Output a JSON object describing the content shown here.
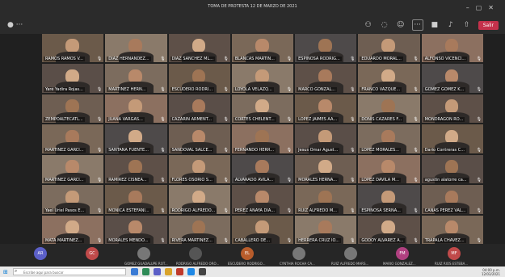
{
  "window": {
    "title": "TOMA DE PROTESTA 12 DE MARZO DE 2021"
  },
  "toolbar": {
    "leave_label": "Salir"
  },
  "tiles": [
    {
      "label": "RAMOS RAMOS V..."
    },
    {
      "label": "DIAZ HERNANDEZ..."
    },
    {
      "label": "DIAZ SANCHEZ ML..."
    },
    {
      "label": "BLANCAS MARTIN..."
    },
    {
      "label": "ESPINOSA RODRIG..."
    },
    {
      "label": "EDUARDO MORAL..."
    },
    {
      "label": "ALFONSO VICENCI..."
    },
    {
      "label": "Yaré Yadira Rojas..."
    },
    {
      "label": "MARTINEZ HERN..."
    },
    {
      "label": "ESCUDERO RODRI..."
    },
    {
      "label": "LOYOLA VELAZQ..."
    },
    {
      "label": "MARCO GONZAL..."
    },
    {
      "label": "FRANCO VAZQUE..."
    },
    {
      "label": "GOMEZ GOMEZ K..."
    },
    {
      "label": "ZEMPOALTECATL..."
    },
    {
      "label": "JUANA VARGAS..."
    },
    {
      "label": "CAZARIN ARMENT..."
    },
    {
      "label": "CORTES CHELENT..."
    },
    {
      "label": "LOPEZ JAIMES AA..."
    },
    {
      "label": "DONIS CAZARES F..."
    },
    {
      "label": "MONDRAGON RO..."
    },
    {
      "label": "MARTINEZ GARCI..."
    },
    {
      "label": "SANTANA FUENTE..."
    },
    {
      "label": "SANDOVAL SALCE..."
    },
    {
      "label": "FERNANDO HERR..."
    },
    {
      "label": "Jesus Omar Agust..."
    },
    {
      "label": "LOPEZ MORALES..."
    },
    {
      "label": "Dario Contreras C..."
    },
    {
      "label": "MARTINEZ GARCI..."
    },
    {
      "label": "RAMIREZ CISNEA..."
    },
    {
      "label": "FLORES OSORIO S..."
    },
    {
      "label": "ALVARADO AVILA..."
    },
    {
      "label": "MORALES HERNA..."
    },
    {
      "label": "LOPEZ DAVILA M..."
    },
    {
      "label": "agustin alatorre ca..."
    },
    {
      "label": "Yael Uriel Pasos E..."
    },
    {
      "label": "MONICA ESTEFANI..."
    },
    {
      "label": "RODRIGO ALFREDO..."
    },
    {
      "label": "PEREZ ANAYA DIA..."
    },
    {
      "label": "RUIZ ALFREDO M..."
    },
    {
      "label": "ESPINOSA SERNA..."
    },
    {
      "label": "CAÑAS PEREZ VAL..."
    },
    {
      "label": "MATA MARTINEZ..."
    },
    {
      "label": "MORALES MENDO..."
    },
    {
      "label": "RIVERA MARTINEZ..."
    },
    {
      "label": "CABALLERO DE..."
    },
    {
      "label": "HERRERA CRUZ IO..."
    },
    {
      "label": "GODOY ALVAREZ A..."
    },
    {
      "label": "TRAPALA CHAVEZ..."
    }
  ],
  "strip": [
    {
      "initials": "AR",
      "color": "#5b5fc7",
      "name": ""
    },
    {
      "initials": "GC",
      "color": "#c04a4a",
      "name": ""
    },
    {
      "initials": "",
      "color": "#777777",
      "name": "GOMEZ GUADALUPE ROT..."
    },
    {
      "initials": "",
      "color": "#555555",
      "name": "RODRIGO ALFREDO ORO..."
    },
    {
      "initials": "EL",
      "color": "#b85c2b",
      "name": "ESCUDERO RODRIGO..."
    },
    {
      "initials": "",
      "color": "#777777",
      "name": "CYNTHIA ROCHA CA..."
    },
    {
      "initials": "",
      "color": "#777777",
      "name": "RUIZ ALFREDO MARS..."
    },
    {
      "initials": "FM",
      "color": "#b04080",
      "name": "MARIO GONZALEZ..."
    },
    {
      "initials": "MF",
      "color": "#c04a4a",
      "name": "RUIZ RIOS ESTEBA..."
    }
  ],
  "taskbar": {
    "search_placeholder": "Escribe aquí para buscar",
    "time": "04:00 p.m.",
    "date": "12/03/2021"
  },
  "colors": {
    "leave": "#c4314b",
    "accent": "#5b5fc7"
  }
}
